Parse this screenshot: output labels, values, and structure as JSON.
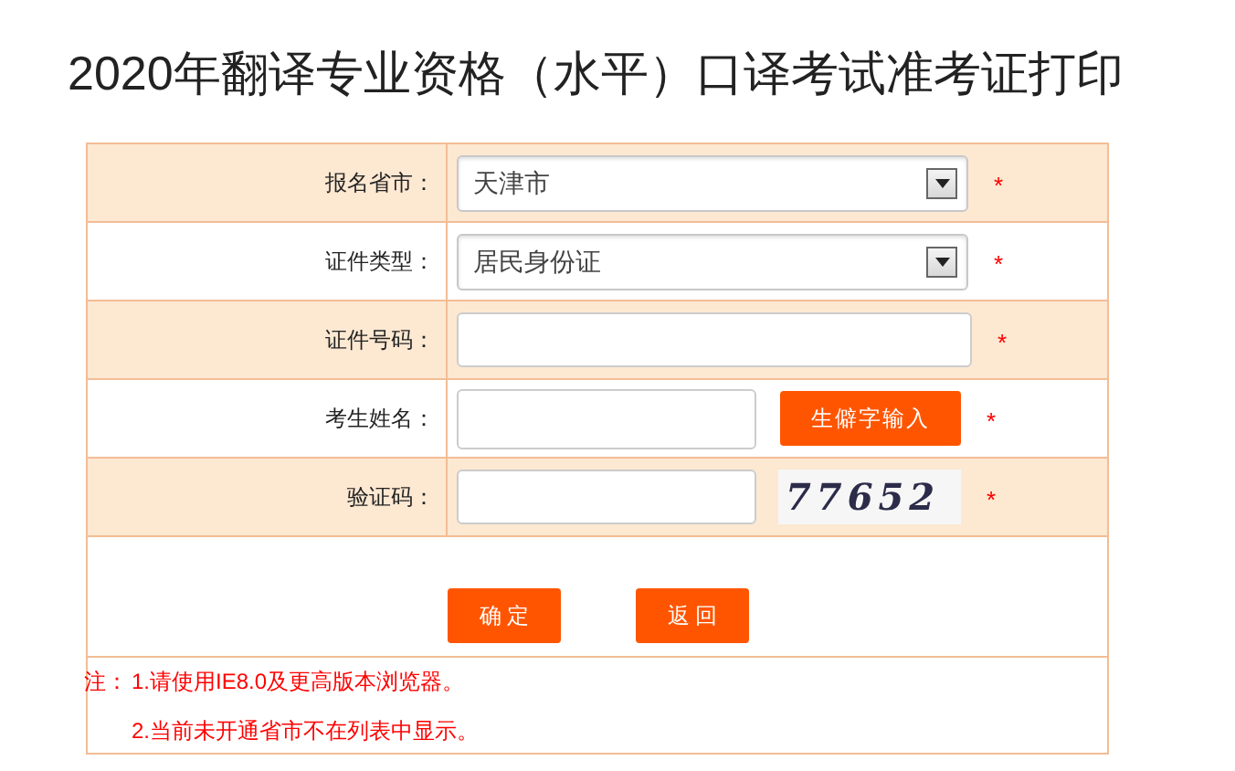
{
  "title": "2020年翻译专业资格（水平）口译考试准考证打印",
  "fields": [
    {
      "label": "报名省市：",
      "kind": "select",
      "value": "天津市",
      "required_mark": "*"
    },
    {
      "label": "证件类型：",
      "kind": "select",
      "value": "居民身份证",
      "required_mark": "*"
    },
    {
      "label": "证件号码：",
      "kind": "text",
      "required_mark": "*"
    },
    {
      "label": "考生姓名：",
      "kind": "text_button",
      "button": "生僻字输入",
      "required_mark": "*"
    },
    {
      "label": "验证码：",
      "kind": "captcha",
      "captcha": "77652",
      "required_mark": "*"
    }
  ],
  "buttons": [
    "确 定",
    "返 回"
  ],
  "notes": [
    {
      "prefix": "注：",
      "number": "1.",
      "text": "请使用IE8.0及更高版本浏览器。"
    },
    {
      "number": "2.",
      "text": "当前未开通省市不在列表中显示。"
    }
  ]
}
